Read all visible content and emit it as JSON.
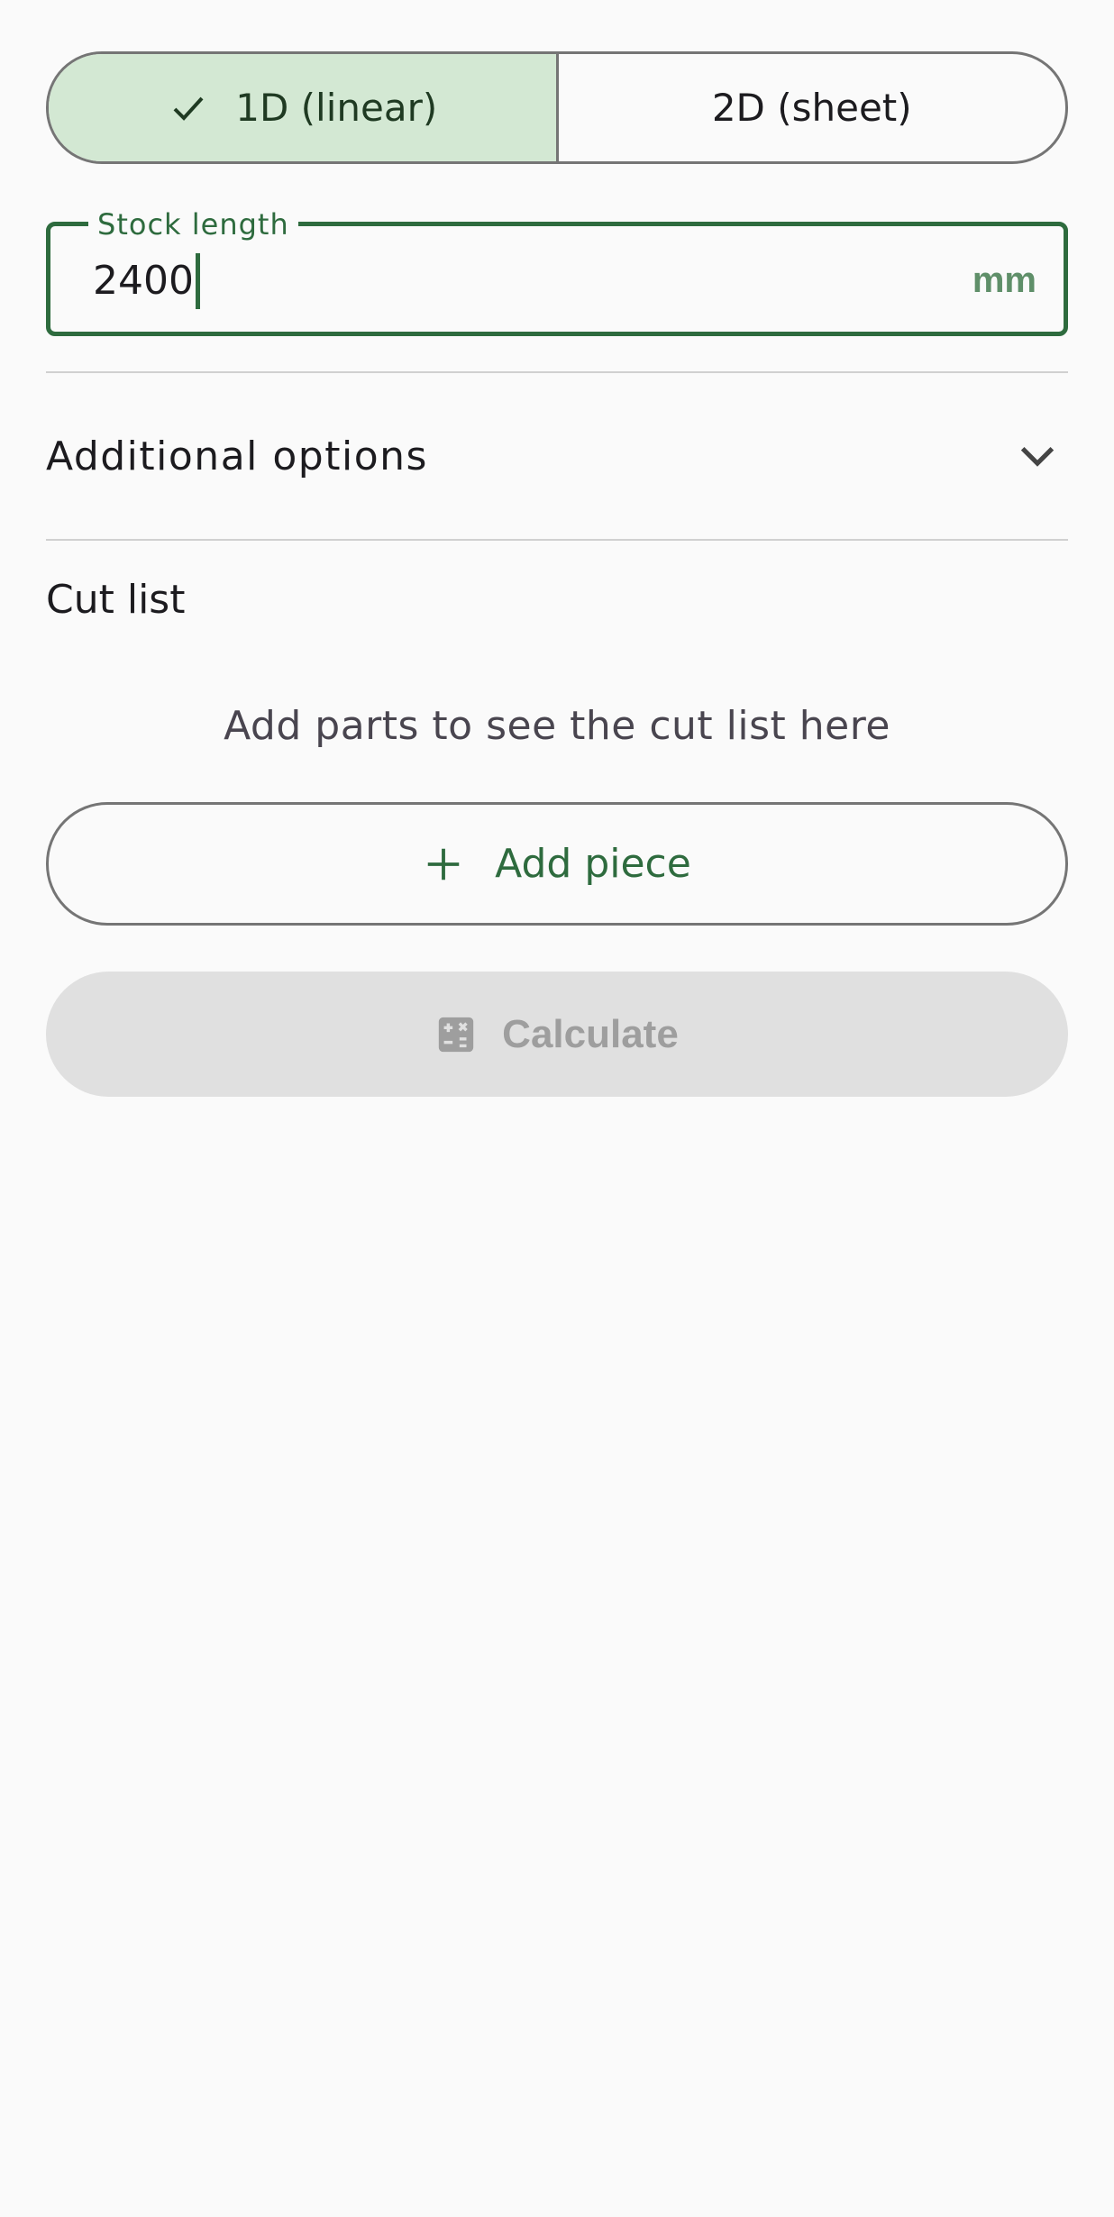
{
  "mode_selector": {
    "options": [
      {
        "label": "1D (linear)",
        "selected": true
      },
      {
        "label": "2D (sheet)",
        "selected": false
      }
    ]
  },
  "stock_length": {
    "label": "Stock length",
    "value": "2400",
    "unit": "mm"
  },
  "additional_options": {
    "title": "Additional options",
    "expanded": false
  },
  "cut_list": {
    "title": "Cut list",
    "empty_message": "Add parts to see the cut list here"
  },
  "actions": {
    "add_piece_label": "Add piece",
    "calculate_label": "Calculate",
    "calculate_enabled": false
  },
  "colors": {
    "primary": "#2e6b3e",
    "selected_segment_bg": "#d3e8d3",
    "disabled_button_bg": "#e0e0e0",
    "disabled_text": "#9e9e9e",
    "outline": "#757575",
    "background": "#fafafa"
  },
  "icons": {
    "selected_segment": "check-icon",
    "expander": "chevron-down-icon",
    "add_piece": "plus-icon",
    "calculate": "calculator-icon"
  }
}
